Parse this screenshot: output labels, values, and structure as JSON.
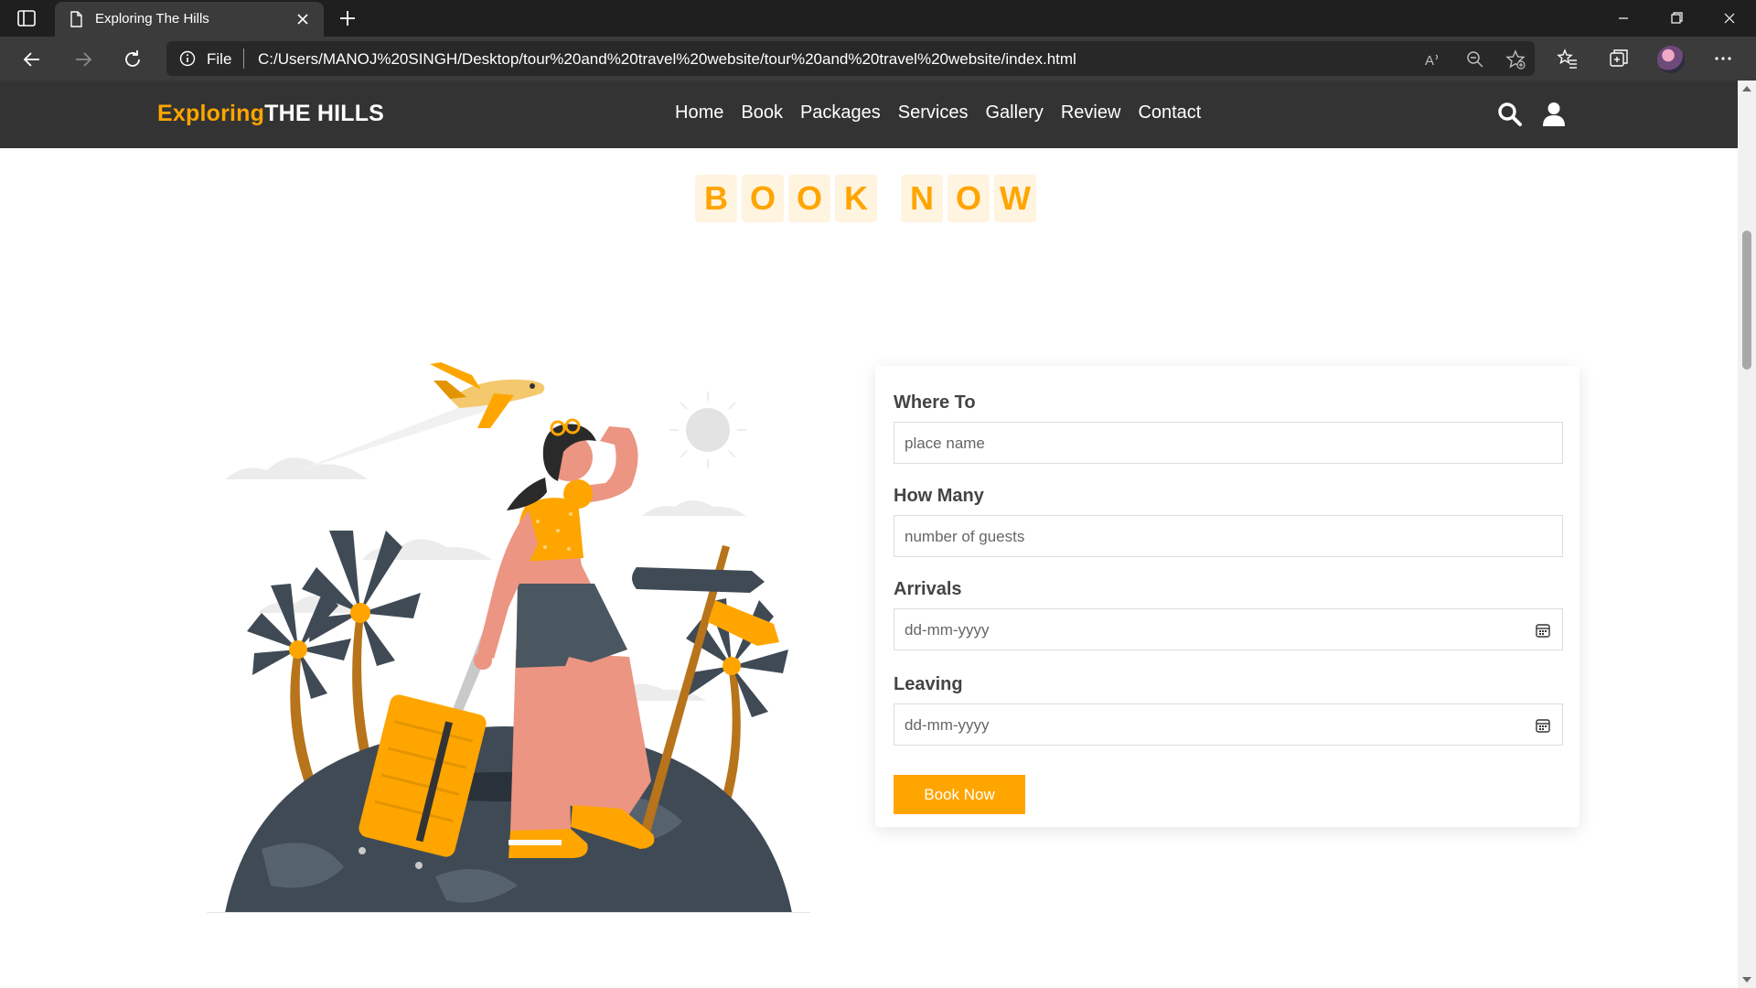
{
  "browser": {
    "tab_title": "Exploring The Hills",
    "address_prefix": "File",
    "url": "C:/Users/MANOJ%20SINGH/Desktop/tour%20and%20travel%20website/tour%20and%20travel%20website/index.html"
  },
  "header": {
    "logo_first": "Exploring",
    "logo_second": "THE HILLS",
    "nav": [
      "Home",
      "Book",
      "Packages",
      "Services",
      "Gallery",
      "Review",
      "Contact"
    ]
  },
  "section": {
    "heading_letters": [
      "B",
      "O",
      "O",
      "K",
      "",
      "N",
      "O",
      "W"
    ]
  },
  "form": {
    "where_label": "Where To",
    "where_placeholder": "place name",
    "howmany_label": "How Many",
    "howmany_placeholder": "number of guests",
    "arrivals_label": "Arrivals",
    "arrivals_value": "dd-mm-yyyy",
    "leaving_label": "Leaving",
    "leaving_value": "dd-mm-yyyy",
    "submit_label": "Book Now"
  },
  "colors": {
    "accent": "#ffa500",
    "header_bg": "#333333",
    "heading_tile": "#fff4e0"
  }
}
